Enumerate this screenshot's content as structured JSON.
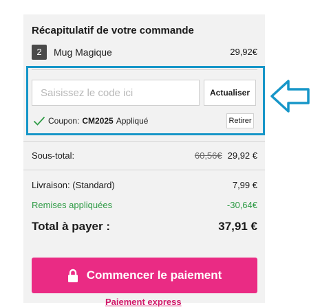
{
  "summary": {
    "title": "Récapitulatif de votre commande",
    "item": {
      "quantity": "2",
      "name": "Mug Magique",
      "price": "29,92€"
    }
  },
  "coupon_form": {
    "placeholder": "Saisissez le code ici",
    "update_label": "Actualiser",
    "applied_prefix": "Coupon:",
    "applied_code": "CM2025",
    "applied_suffix": "Appliqué",
    "remove_label": "Retirer"
  },
  "totals": {
    "subtotal_label": "Sous-total:",
    "subtotal_original": "60,56€",
    "subtotal_value": "29,92 €",
    "shipping_label": "Livraison: (Standard)",
    "shipping_value": "7,99 €",
    "discount_label": "Remises appliquées",
    "discount_value": "-30,64€",
    "total_label": "Total à payer :",
    "total_value": "37,91 €"
  },
  "actions": {
    "pay_label": "Commencer le paiement",
    "express_label": "Paiement express"
  },
  "icons": {
    "check": "check-icon",
    "lock": "lock-icon",
    "arrow": "arrow-left-icon"
  },
  "colors": {
    "highlight": "#1796c8",
    "pay_button": "#ea2b84",
    "discount_green": "#2e9b45"
  }
}
